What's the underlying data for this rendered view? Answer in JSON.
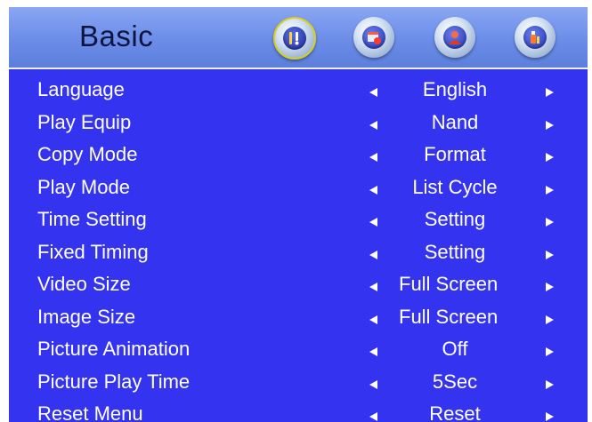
{
  "header": {
    "title": "Basic",
    "tabs": [
      {
        "icon": "settings-tools-icon",
        "active": true
      },
      {
        "icon": "calendar-clock-icon",
        "active": false
      },
      {
        "icon": "user-person-icon",
        "active": false
      },
      {
        "icon": "info-bottle-icon",
        "active": false
      }
    ]
  },
  "colors": {
    "background": "#3434f0",
    "header": "#7b97ec",
    "text": "#ffffff",
    "title": "#0d1540",
    "active_ring": "#d8d020"
  },
  "menu": {
    "items": [
      {
        "label": "Language",
        "value": "English"
      },
      {
        "label": "Play Equip",
        "value": "Nand"
      },
      {
        "label": "Copy Mode",
        "value": "Format"
      },
      {
        "label": "Play Mode",
        "value": "List Cycle"
      },
      {
        "label": "Time Setting",
        "value": "Setting"
      },
      {
        "label": "Fixed Timing",
        "value": "Setting"
      },
      {
        "label": "Video Size",
        "value": "Full Screen"
      },
      {
        "label": "Image Size",
        "value": "Full Screen"
      },
      {
        "label": "Picture Animation",
        "value": "Off"
      },
      {
        "label": "Picture Play Time",
        "value": "5Sec"
      },
      {
        "label": "Reset Menu",
        "value": "Reset"
      }
    ]
  }
}
